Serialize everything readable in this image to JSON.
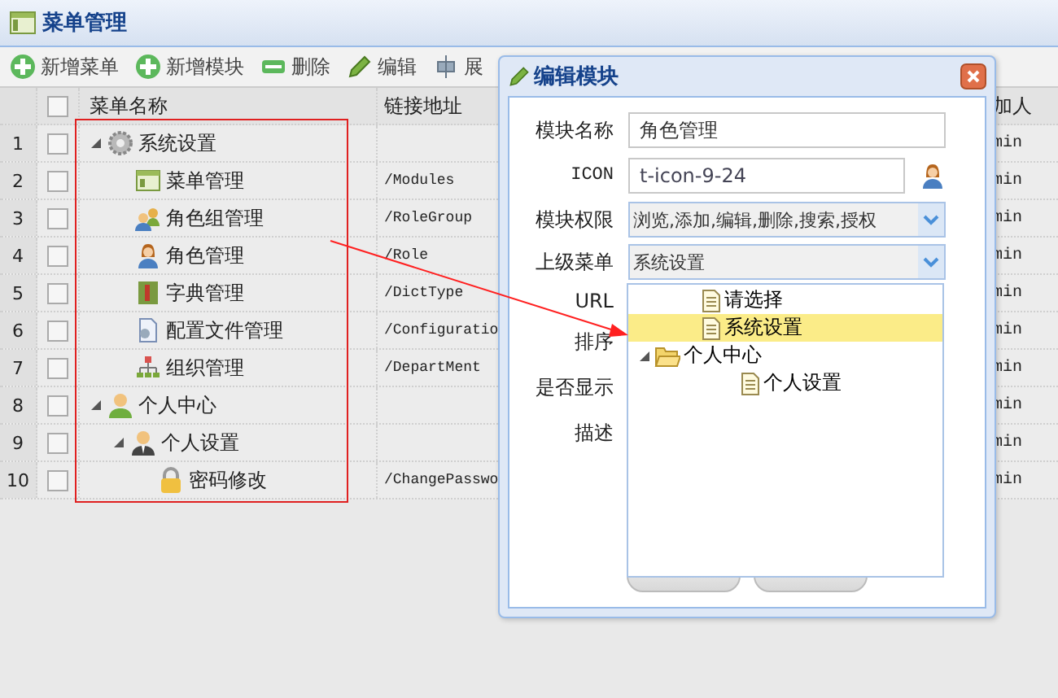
{
  "window": {
    "title": "菜单管理"
  },
  "toolbar": [
    {
      "label": "新增菜单",
      "kind": "add"
    },
    {
      "label": "新增模块",
      "kind": "add"
    },
    {
      "label": "删除",
      "kind": "remove"
    },
    {
      "label": "编辑",
      "kind": "edit"
    },
    {
      "label": "展",
      "kind": "expand"
    }
  ],
  "table": {
    "all_checked": false,
    "columns": [
      "菜单名称",
      "链接地址",
      "加人"
    ],
    "rows": [
      {
        "num": "1",
        "checked": false,
        "name": "系统设置",
        "kind": "gear",
        "expanded": true,
        "column_3": "min",
        "children": [
          {
            "num": "2",
            "checked": false,
            "name": "菜单管理",
            "kind": "grid",
            "link": "/Modules",
            "column_3": "min"
          },
          {
            "num": "3",
            "checked": false,
            "name": "角色组管理",
            "kind": "users",
            "link": "/RoleGroup",
            "column_3": "min"
          },
          {
            "num": "4",
            "checked": false,
            "name": "角色管理",
            "kind": "woman",
            "link": "/Role",
            "column_3": "min"
          },
          {
            "num": "5",
            "checked": false,
            "name": "字典管理",
            "kind": "book",
            "link": "/DictType",
            "column_3": "min"
          },
          {
            "num": "6",
            "checked": false,
            "name": "配置文件管理",
            "kind": "file",
            "link": "/Configuratio",
            "column_3": "min"
          },
          {
            "num": "7",
            "checked": false,
            "name": "组织管理",
            "kind": "org",
            "link": "/DepartMent",
            "column_3": "min"
          }
        ]
      },
      {
        "num": "8",
        "checked": false,
        "name": "个人中心",
        "kind": "person",
        "expanded": true,
        "column_3": "min",
        "children": [
          {
            "num": "9",
            "checked": false,
            "name": "个人设置",
            "kind": "suit",
            "expanded": true,
            "column_3": "min",
            "children": [
              {
                "num": "10",
                "checked": false,
                "name": "密码修改",
                "kind": "lock",
                "link": "/ChangePasswo",
                "column_3": "min"
              }
            ]
          }
        ]
      }
    ]
  },
  "dialog": {
    "title": "编辑模块",
    "fields": [
      {
        "label": "模块名称",
        "kind": "text",
        "value": "角色管理"
      },
      {
        "label": "ICON",
        "kind": "icon",
        "value": "t-icon-9-24"
      },
      {
        "label": "模块权限",
        "kind": "select",
        "value": "浏览,添加,编辑,删除,搜索,授权"
      },
      {
        "label": "上级菜单",
        "kind": "select",
        "value": "系统设置"
      },
      {
        "label": "URL",
        "kind": "hidden"
      },
      {
        "label": "排序",
        "kind": "hidden"
      },
      {
        "label": "是否显示",
        "kind": "hidden"
      },
      {
        "label": "描述",
        "kind": "hidden"
      }
    ],
    "dropdown": [
      {
        "label": "请选择",
        "kind": "file",
        "selected": false
      },
      {
        "label": "系统设置",
        "kind": "file",
        "selected": true
      },
      {
        "label": "个人中心",
        "kind": "folder",
        "selected": false,
        "expanded": true,
        "children": [
          {
            "label": "个人设置",
            "kind": "file",
            "selected": false
          }
        ]
      }
    ]
  }
}
